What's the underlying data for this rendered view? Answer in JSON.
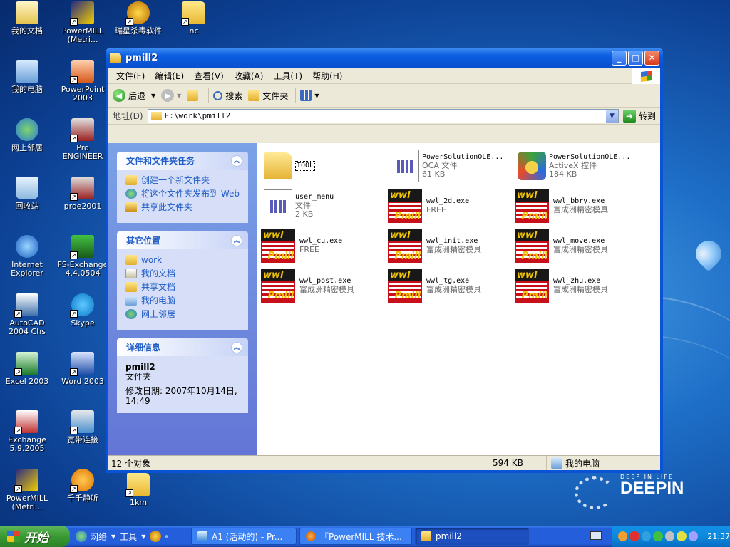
{
  "desktop": {
    "icons": [
      {
        "label": "我的文档"
      },
      {
        "label": "PowerMILL (Metri..."
      },
      {
        "label": "瑞星杀毒软件"
      },
      {
        "label": "nc"
      },
      {
        "label": "我的电脑"
      },
      {
        "label": "PowerPoint 2003"
      },
      {
        "label": "网上邻居"
      },
      {
        "label": "Pro ENGINEER"
      },
      {
        "label": "回收站"
      },
      {
        "label": "proe2001"
      },
      {
        "label": "Internet Explorer"
      },
      {
        "label": "FS-Exchange 4.4.0504"
      },
      {
        "label": "AutoCAD 2004 Chs"
      },
      {
        "label": "Skype"
      },
      {
        "label": "Excel 2003"
      },
      {
        "label": "Word 2003"
      },
      {
        "label": "Exchange 5.9.2005"
      },
      {
        "label": "宽带连接"
      },
      {
        "label": "PowerMILL (Metri..."
      },
      {
        "label": "千千静听"
      },
      {
        "label": "1km"
      }
    ],
    "branding": {
      "tagline": "DEEP IN LIFE",
      "name": "DEEPIN"
    }
  },
  "window": {
    "title": "pmill2",
    "menu": [
      "文件(F)",
      "编辑(E)",
      "查看(V)",
      "收藏(A)",
      "工具(T)",
      "帮助(H)"
    ],
    "toolbar": {
      "back": "后退",
      "search": "搜索",
      "folders": "文件夹"
    },
    "address": {
      "label": "地址(D)",
      "value": "E:\\work\\pmill2",
      "go": "转到"
    },
    "left_panels": {
      "tasks": {
        "title": "文件和文件夹任务",
        "items": [
          "创建一个新文件夹",
          "将这个文件夹发布到 Web",
          "共享此文件夹"
        ]
      },
      "places": {
        "title": "其它位置",
        "items": [
          "work",
          "我的文档",
          "共享文档",
          "我的电脑",
          "网上邻居"
        ]
      },
      "details": {
        "title": "详细信息",
        "name": "pmill2",
        "type": "文件夹",
        "modified": "修改日期: 2007年10月14日, 14:49"
      }
    },
    "files": [
      {
        "name": "TOOL",
        "line2": "",
        "line3": "",
        "icon": "folder-icon"
      },
      {
        "name": "PowerSolutionOLE...",
        "line2": "OCA 文件",
        "line3": "61 KB",
        "icon": "oca-file-icon"
      },
      {
        "name": "PowerSolutionOLE...",
        "line2": "ActiveX 控件",
        "line3": "184 KB",
        "icon": "activex-icon"
      },
      {
        "name": "user_menu",
        "line2": "文件",
        "line3": "2 KB",
        "icon": "file-icon"
      },
      {
        "name": "wwl_2d.exe",
        "line2": "FREE",
        "line3": "",
        "icon": "wwl-pmill-icon"
      },
      {
        "name": "wwl_bbry.exe",
        "line2": "富成洲精密模具",
        "line3": "",
        "icon": "wwl-pmill-icon"
      },
      {
        "name": "wwl_cu.exe",
        "line2": "FREE",
        "line3": "",
        "icon": "wwl-pmill-icon"
      },
      {
        "name": "wwl_init.exe",
        "line2": "富成洲精密模具",
        "line3": "",
        "icon": "wwl-pmill-icon"
      },
      {
        "name": "wwl_move.exe",
        "line2": "富成洲精密模具",
        "line3": "",
        "icon": "wwl-pmill-icon"
      },
      {
        "name": "wwl_post.exe",
        "line2": "富成洲精密模具",
        "line3": "",
        "icon": "wwl-pmill-icon"
      },
      {
        "name": "wwl_tg.exe",
        "line2": "富成洲精密模具",
        "line3": "",
        "icon": "wwl-pmill-icon"
      },
      {
        "name": "wwl_zhu.exe",
        "line2": "富成洲精密模具",
        "line3": "",
        "icon": "wwl-pmill-icon"
      }
    ],
    "status": {
      "count": "12 个对象",
      "size": "594 KB",
      "location": "我的电脑"
    }
  },
  "taskbar": {
    "start": "开始",
    "quicklaunch": [
      "网络",
      "工具"
    ],
    "tasks": [
      "A1 (活动的) - Pr...",
      "『PowerMILL 技术...",
      "pmill2"
    ],
    "clock": "21:37"
  },
  "colors": {
    "xp_blue": "#0a53d6",
    "panel_link": "#215dc6",
    "start_green": "#3a9a32"
  }
}
